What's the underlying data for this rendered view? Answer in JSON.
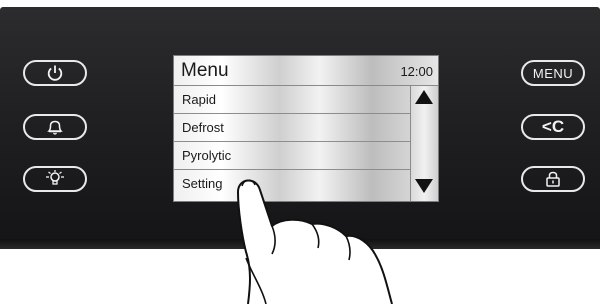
{
  "screen": {
    "title": "Menu",
    "time": "12:00",
    "items": [
      {
        "label": "Rapid"
      },
      {
        "label": "Defrost"
      },
      {
        "label": "Pyrolytic"
      },
      {
        "label": "Setting"
      }
    ]
  },
  "buttons": {
    "menu_label": "MENU",
    "back_label": "<C"
  },
  "icons": {
    "power": "power-icon",
    "bell": "bell-icon",
    "light": "light-bulb-icon",
    "scroll_up": "triangle-up-icon",
    "scroll_down": "triangle-down-icon",
    "lock": "lock-icon",
    "hand": "hand-pointer-icon"
  },
  "colors": {
    "panel": "#202022",
    "button_border": "#e9e9e9",
    "screen_text": "#1a1a1a"
  }
}
